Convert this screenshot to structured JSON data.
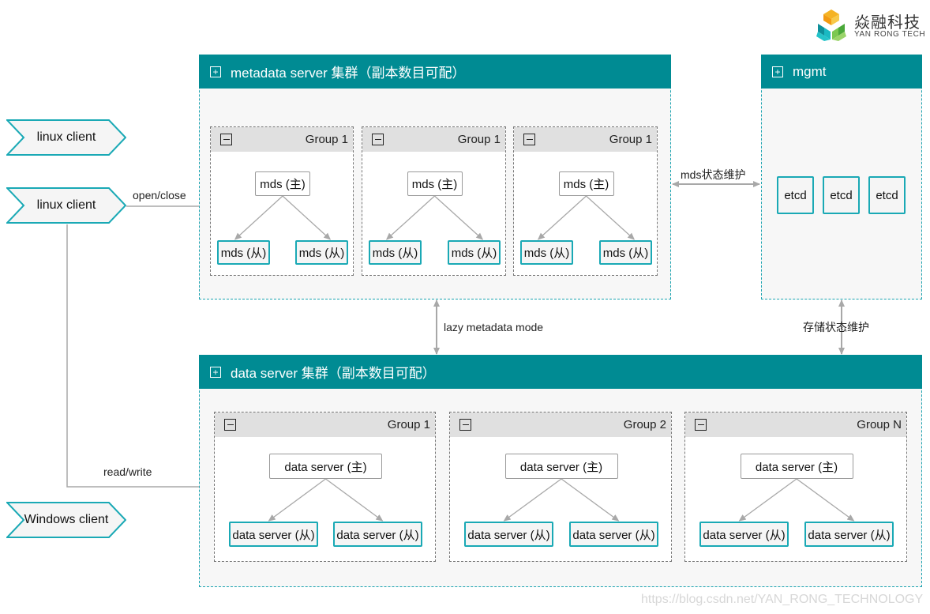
{
  "logo": {
    "cn_name": "焱融科技",
    "en_name": "YAN RONG TECH",
    "colors": [
      "#f5a31a",
      "#1ab0b8",
      "#6cc04a",
      "#0e7f8c"
    ]
  },
  "clients": [
    {
      "label": "linux client"
    },
    {
      "label": "linux client"
    },
    {
      "label": "Windows client"
    }
  ],
  "edges": {
    "open_close": "open/close",
    "read_write": "read/write",
    "mds_state": "mds状态维护",
    "lazy_metadata": "lazy metadata mode",
    "storage_state": "存储状态维护"
  },
  "metadata_cluster": {
    "title": "metadata server 集群（副本数目可配）",
    "groups": [
      {
        "title": "Group 1",
        "master": "mds (主)",
        "slaves": [
          "mds (从)",
          "mds (从)"
        ]
      },
      {
        "title": "Group 1",
        "master": "mds (主)",
        "slaves": [
          "mds (从)",
          "mds (从)"
        ]
      },
      {
        "title": "Group 1",
        "master": "mds (主)",
        "slaves": [
          "mds (从)",
          "mds (从)"
        ]
      }
    ]
  },
  "mgmt_cluster": {
    "title": "mgmt",
    "nodes": [
      "etcd",
      "etcd",
      "etcd"
    ]
  },
  "data_cluster": {
    "title": "data server 集群（副本数目可配）",
    "groups": [
      {
        "title": "Group 1",
        "master": "data server (主)",
        "slaves": [
          "data server (从)",
          "data server (从)"
        ]
      },
      {
        "title": "Group 2",
        "master": "data server (主)",
        "slaves": [
          "data server (从)",
          "data server (从)"
        ]
      },
      {
        "title": "Group N",
        "master": "data server (主)",
        "slaves": [
          "data server (从)",
          "data server (从)"
        ]
      }
    ]
  },
  "theme": {
    "header_color": "#008b93",
    "slave_border": "#1aa9b5",
    "arrow_color": "#a8a8a8"
  },
  "watermark": "https://blog.csdn.net/YAN_RONG_TECHNOLOGY"
}
